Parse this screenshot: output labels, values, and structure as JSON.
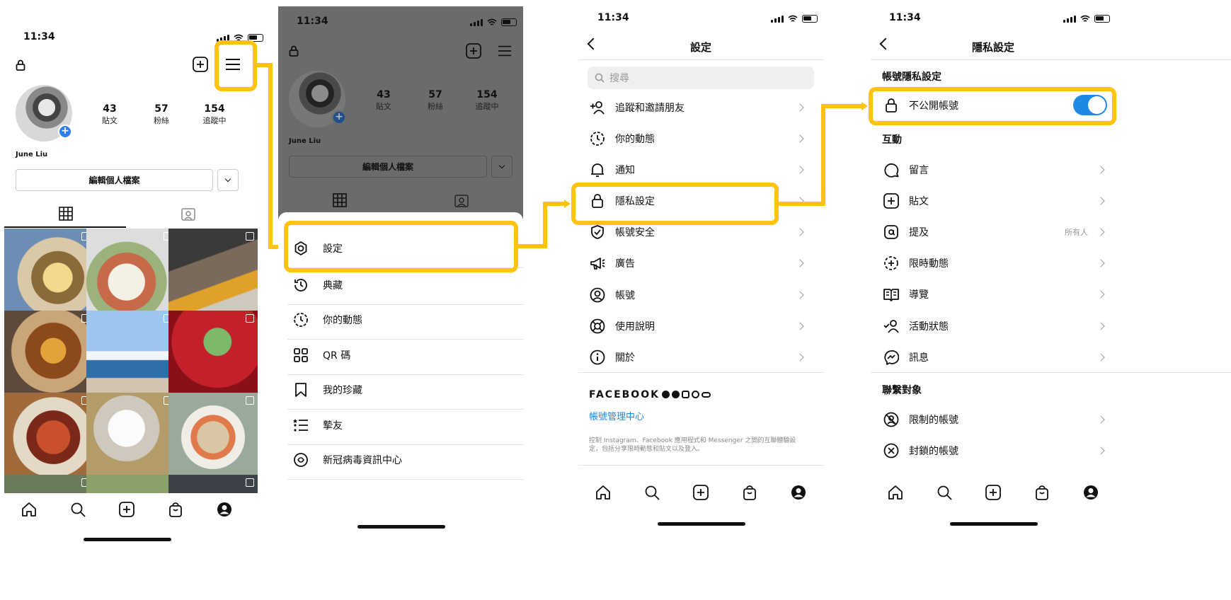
{
  "status": {
    "time": "11:34"
  },
  "profile": {
    "name": "June Liu",
    "stats": [
      {
        "num": "43",
        "label": "貼文"
      },
      {
        "num": "57",
        "label": "粉絲"
      },
      {
        "num": "154",
        "label": "追蹤中"
      }
    ],
    "edit_button": "編輯個人檔案"
  },
  "menu": {
    "items": [
      {
        "label": "設定",
        "icon": "settings-icon"
      },
      {
        "label": "典藏",
        "icon": "archive-icon"
      },
      {
        "label": "你的動態",
        "icon": "activity-icon"
      },
      {
        "label": "QR 碼",
        "icon": "qr-code-icon"
      },
      {
        "label": "我的珍藏",
        "icon": "bookmark-icon"
      },
      {
        "label": "摯友",
        "icon": "close-friends-icon"
      },
      {
        "label": "新冠病毒資訊中心",
        "icon": "covid-info-icon"
      }
    ]
  },
  "settings": {
    "title": "設定",
    "search_placeholder": "搜尋",
    "items": [
      {
        "label": "追蹤和邀請朋友",
        "icon": "add-person-icon"
      },
      {
        "label": "你的動態",
        "icon": "activity-icon"
      },
      {
        "label": "通知",
        "icon": "bell-icon"
      },
      {
        "label": "隱私設定",
        "icon": "lock-icon"
      },
      {
        "label": "帳號安全",
        "icon": "shield-icon"
      },
      {
        "label": "廣告",
        "icon": "megaphone-icon"
      },
      {
        "label": "帳號",
        "icon": "account-icon"
      },
      {
        "label": "使用說明",
        "icon": "lifebuoy-icon"
      },
      {
        "label": "關於",
        "icon": "info-icon"
      }
    ],
    "facebook_brand": "FACEBOOK",
    "accounts_center": "帳號管理中心",
    "accounts_center_desc_1": "控制 Instagram、Facebook 應用程式和 Messenger 之間的互聯體驗設",
    "accounts_center_desc_2": "定，包括分享限時動態和貼文以及登入。"
  },
  "privacy": {
    "title": "隱私設定",
    "section_account": "帳號隱私設定",
    "private_account_label": "不公開帳號",
    "private_account_on": true,
    "section_interactions": "互動",
    "interactions": [
      {
        "label": "留言",
        "value": "",
        "icon": "comment-icon"
      },
      {
        "label": "貼文",
        "value": "",
        "icon": "post-icon"
      },
      {
        "label": "提及",
        "value": "所有人",
        "icon": "mention-icon"
      },
      {
        "label": "限時動態",
        "value": "",
        "icon": "story-icon"
      },
      {
        "label": "導覽",
        "value": "",
        "icon": "guide-icon"
      },
      {
        "label": "活動狀態",
        "value": "",
        "icon": "activity-status-icon"
      },
      {
        "label": "訊息",
        "value": "",
        "icon": "messenger-icon"
      }
    ],
    "section_connections": "聯繫對象",
    "connections": [
      {
        "label": "限制的帳號",
        "icon": "restricted-icon"
      },
      {
        "label": "封鎖的帳號",
        "icon": "blocked-icon"
      }
    ]
  },
  "colors": {
    "highlight": "#ffc20e",
    "link": "#1e88e5",
    "toggle": "#1e88e5"
  }
}
